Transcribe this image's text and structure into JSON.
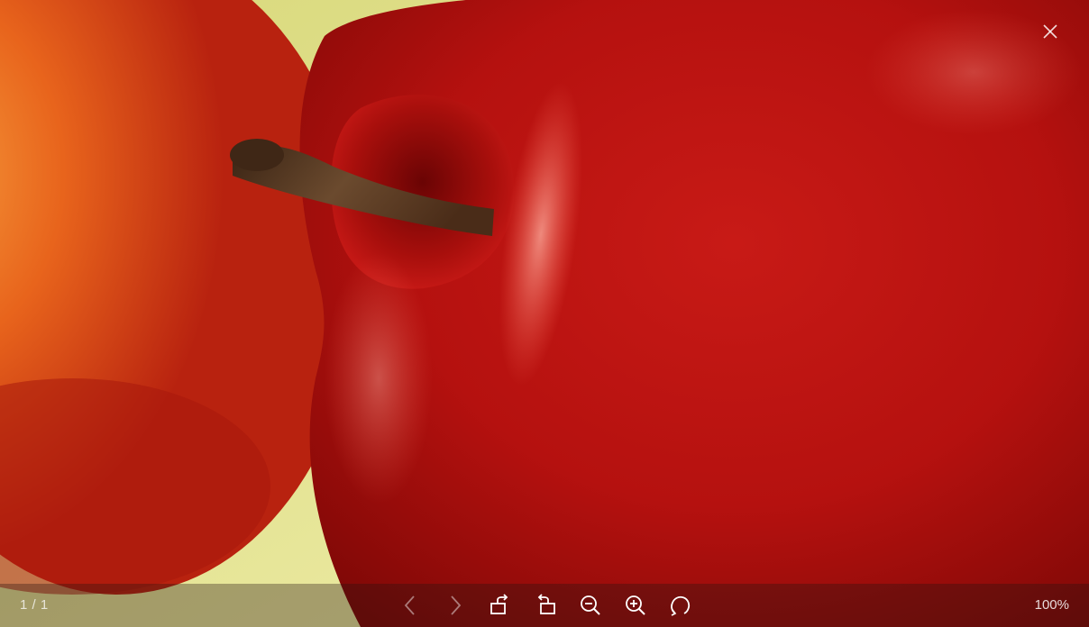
{
  "viewer": {
    "counter": "1 / 1",
    "zoom": "100%"
  },
  "icons": {
    "close": "close-icon",
    "prev": "chevron-left-icon",
    "next": "chevron-right-icon",
    "rotate_right": "rotate-right-icon",
    "rotate_left": "rotate-left-icon",
    "zoom_out": "zoom-out-icon",
    "zoom_in": "zoom-in-icon",
    "reset": "reset-icon"
  },
  "colors": {
    "apple_red": "#b5110f",
    "apple_highlight": "#e8504a",
    "background_orange": "#e8641c",
    "background_green": "#dfe09a",
    "stem_brown": "#5a3a22",
    "toolbar_icon": "#ffffff"
  }
}
